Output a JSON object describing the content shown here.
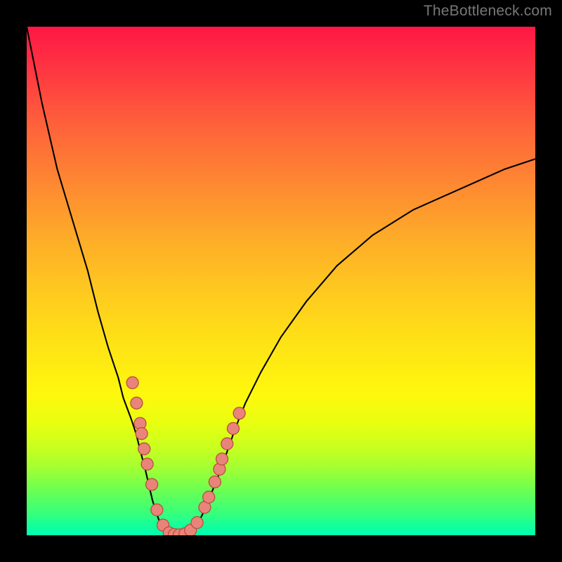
{
  "watermark": "TheBottleneck.com",
  "chart_data": {
    "type": "line",
    "title": "",
    "xlabel": "",
    "ylabel": "",
    "x_range": [
      0,
      100
    ],
    "y_range": [
      0,
      100
    ],
    "curve_y_of_x": [
      [
        0,
        100
      ],
      [
        3,
        85
      ],
      [
        6,
        72
      ],
      [
        9,
        62
      ],
      [
        12,
        52
      ],
      [
        14,
        44
      ],
      [
        16,
        37
      ],
      [
        18,
        31
      ],
      [
        19,
        27
      ],
      [
        20.5,
        23
      ],
      [
        21.5,
        20
      ],
      [
        22.5,
        16
      ],
      [
        23.3,
        13
      ],
      [
        24,
        10
      ],
      [
        24.7,
        7
      ],
      [
        25.3,
        5
      ],
      [
        26,
        3
      ],
      [
        26.8,
        1.5
      ],
      [
        27.6,
        0.8
      ],
      [
        28.4,
        0.3
      ],
      [
        29.3,
        0.05
      ],
      [
        30.3,
        0.05
      ],
      [
        31.2,
        0.3
      ],
      [
        32.1,
        0.8
      ],
      [
        33,
        1.6
      ],
      [
        34,
        3
      ],
      [
        35,
        5
      ],
      [
        36,
        7.5
      ],
      [
        37,
        10
      ],
      [
        38.2,
        13
      ],
      [
        39.6,
        17
      ],
      [
        41,
        21
      ],
      [
        43,
        26
      ],
      [
        46,
        32
      ],
      [
        50,
        39
      ],
      [
        55,
        46
      ],
      [
        61,
        53
      ],
      [
        68,
        59
      ],
      [
        76,
        64
      ],
      [
        85,
        68
      ],
      [
        94,
        72
      ],
      [
        100,
        74
      ]
    ],
    "markers_y_of_x": [
      [
        20.8,
        30
      ],
      [
        21.6,
        26
      ],
      [
        22.3,
        22
      ],
      [
        22.6,
        20
      ],
      [
        23.1,
        17
      ],
      [
        23.7,
        14
      ],
      [
        24.6,
        10
      ],
      [
        25.6,
        5
      ],
      [
        26.8,
        2
      ],
      [
        28.0,
        0.5
      ],
      [
        29.0,
        0.15
      ],
      [
        30.0,
        0.1
      ],
      [
        31.1,
        0.3
      ],
      [
        32.2,
        1.0
      ],
      [
        33.5,
        2.5
      ],
      [
        35.0,
        5.5
      ],
      [
        35.8,
        7.5
      ],
      [
        37.0,
        10.5
      ],
      [
        37.9,
        13
      ],
      [
        38.4,
        15
      ],
      [
        39.4,
        18
      ],
      [
        40.6,
        21
      ],
      [
        41.8,
        24
      ]
    ]
  }
}
